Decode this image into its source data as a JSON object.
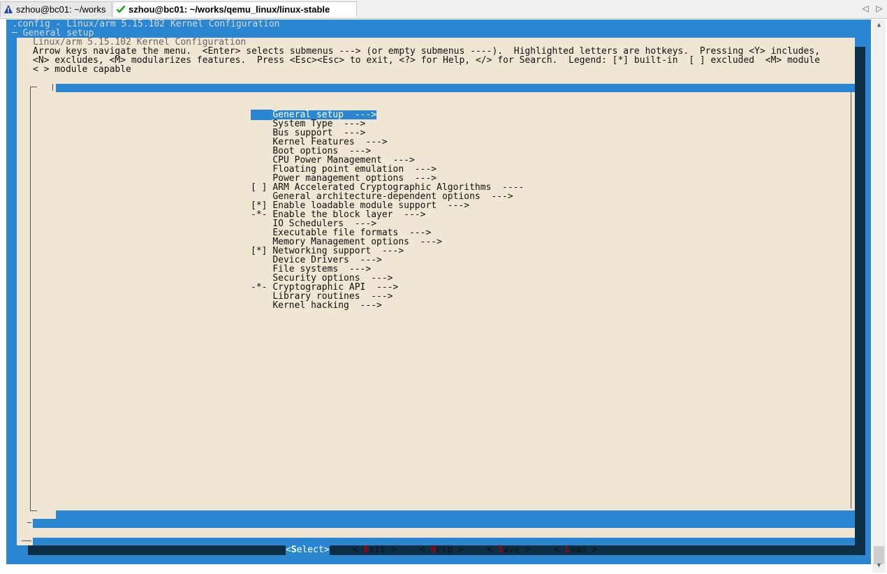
{
  "tabs": [
    {
      "label": "szhou@bc01: ~/works",
      "icon": "warning-triangle-icon",
      "active": false
    },
    {
      "label": "szhou@bc01: ~/works/qemu_linux/linux-stable",
      "icon": "green-check-icon",
      "active": true
    }
  ],
  "tab_nav": {
    "prev": "◁",
    "next": "▷"
  },
  "terminal": {
    "header_line1": ".config - Linux/arm 5.15.102 Kernel Configuration",
    "header_line2": "─ General setup",
    "dialog_title": "Linux/arm 5.15.102 Kernel Configuration",
    "help_lines": [
      "Arrow keys navigate the menu.  <Enter> selects submenus ---> (or empty submenus ----).  Highlighted letters are hotkeys.  Pressing <Y> includes,",
      "<N> excludes, <M> modularizes features.  Press <Esc><Esc> to exit, <?> for Help, </> for Search.  Legend: [*] built-in  [ ] excluded  <M> module",
      "< > module capable"
    ],
    "menu_items": [
      {
        "prefix": "    ",
        "text": "General setup  --->",
        "selected": true
      },
      {
        "prefix": "    ",
        "text": "System Type  --->"
      },
      {
        "prefix": "    ",
        "text": "Bus support  --->"
      },
      {
        "prefix": "    ",
        "text": "Kernel Features  --->"
      },
      {
        "prefix": "    ",
        "text": "Boot options  --->"
      },
      {
        "prefix": "    ",
        "text": "CPU Power Management  --->"
      },
      {
        "prefix": "    ",
        "text": "Floating point emulation  --->"
      },
      {
        "prefix": "    ",
        "text": "Power management options  --->"
      },
      {
        "prefix": "[ ] ",
        "text": "ARM Accelerated Cryptographic Algorithms  ----"
      },
      {
        "prefix": "    ",
        "text": "General architecture-dependent options  --->"
      },
      {
        "prefix": "[*] ",
        "text": "Enable loadable module support  --->"
      },
      {
        "prefix": "-*- ",
        "text": "Enable the block layer  --->"
      },
      {
        "prefix": "    ",
        "text": "IO Schedulers  --->"
      },
      {
        "prefix": "    ",
        "text": "Executable file formats  --->"
      },
      {
        "prefix": "    ",
        "text": "Memory Management options  --->"
      },
      {
        "prefix": "[*] ",
        "text": "Networking support  --->"
      },
      {
        "prefix": "    ",
        "text": "Device Drivers  --->"
      },
      {
        "prefix": "    ",
        "text": "File systems  --->"
      },
      {
        "prefix": "    ",
        "text": "Security options  --->"
      },
      {
        "prefix": "-*- ",
        "text": "Cryptographic API  --->"
      },
      {
        "prefix": "    ",
        "text": "Library routines  --->"
      },
      {
        "prefix": "    ",
        "text": "Kernel hacking  --->"
      }
    ],
    "buttons": [
      {
        "open": "<",
        "hotkey": "S",
        "rest": "elect",
        "close": ">",
        "selected": true
      },
      {
        "open": "< ",
        "hotkey": "E",
        "rest": "xit",
        "close": " >"
      },
      {
        "open": "< ",
        "hotkey": "H",
        "rest": "elp",
        "close": " >"
      },
      {
        "open": "< ",
        "hotkey": "S",
        "rest": "ave",
        "close": " >"
      },
      {
        "open": "< ",
        "hotkey": "L",
        "rest": "oad",
        "close": " >"
      }
    ]
  },
  "colors": {
    "terminal_blue": "#2a86d0",
    "dialog_bg": "#efe6d3",
    "shadow": "#0c2f45",
    "hotkey_red": "#b00000"
  }
}
